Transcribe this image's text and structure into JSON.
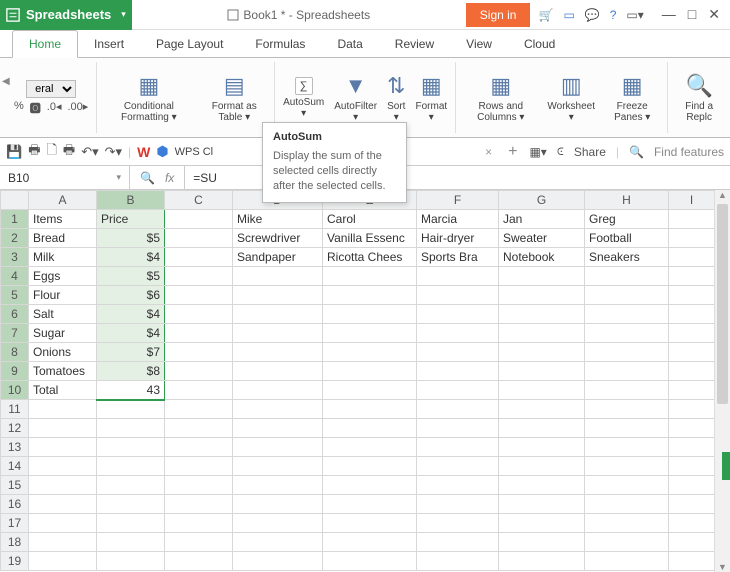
{
  "app": {
    "name": "Spreadsheets",
    "doc_title": "Book1 * - Spreadsheets",
    "signin": "Sign in"
  },
  "tabs": {
    "home": "Home",
    "insert": "Insert",
    "page_layout": "Page Layout",
    "formulas": "Formulas",
    "data": "Data",
    "review": "Review",
    "view": "View",
    "cloud": "Cloud"
  },
  "ribbon": {
    "number_format": "eral",
    "cond_fmt": "Conditional Formatting",
    "fmt_table": "Format as Table",
    "autosum": "AutoSum",
    "autofilter": "AutoFilter",
    "sort": "Sort",
    "format": "Format",
    "rows_cols": "Rows and Columns",
    "worksheet": "Worksheet",
    "freeze": "Freeze Panes",
    "find_repl": "Find a Replc"
  },
  "quickbar": {
    "wps": "WPS Cl",
    "share": "Share",
    "find_features": "Find features"
  },
  "tooltip": {
    "title": "AutoSum",
    "body": "Display the sum of the selected cells directly after the selected cells."
  },
  "namebox": "B10",
  "formula": "=SU",
  "headers": [
    "A",
    "B",
    "C",
    "D",
    "E",
    "F",
    "G",
    "H",
    "I"
  ],
  "rows": [
    {
      "A": "Items",
      "B": "Price",
      "D": "Mike",
      "E": "Carol",
      "F": "Marcia",
      "G": "Jan",
      "H": "Greg"
    },
    {
      "A": "Bread",
      "B": "$5",
      "D": "Screwdriver",
      "E": "Vanilla Essenc",
      "F": "Hair-dryer",
      "G": "Sweater",
      "H": "Football"
    },
    {
      "A": "Milk",
      "B": "$4",
      "D": "Sandpaper",
      "E": "Ricotta Chees",
      "F": "Sports Bra",
      "G": "Notebook",
      "H": "Sneakers"
    },
    {
      "A": "Eggs",
      "B": "$5"
    },
    {
      "A": "Flour",
      "B": "$6"
    },
    {
      "A": "Salt",
      "B": "$4"
    },
    {
      "A": "Sugar",
      "B": "$4"
    },
    {
      "A": "Onions",
      "B": "$7"
    },
    {
      "A": "Tomatoes",
      "B": "$8"
    },
    {
      "A": "Total",
      "B": "43"
    }
  ]
}
